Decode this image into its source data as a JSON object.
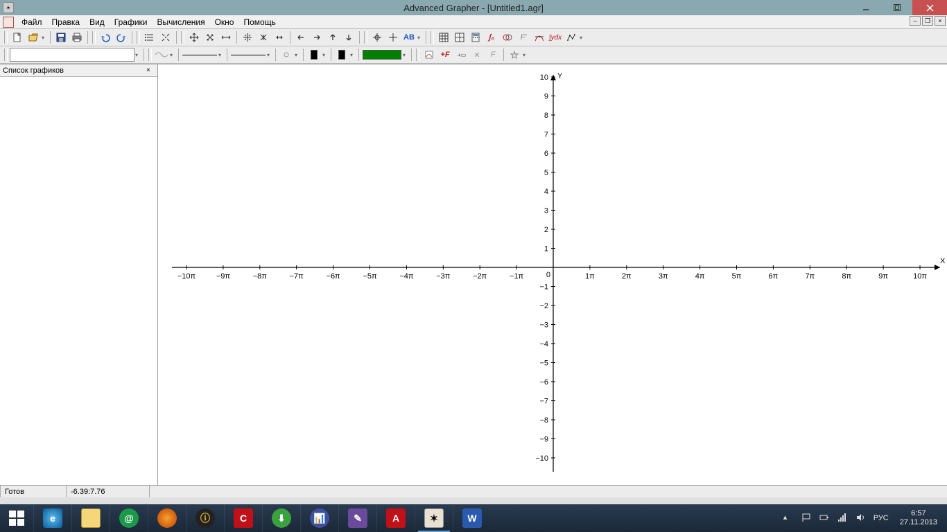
{
  "titlebar": {
    "title": "Advanced Grapher - [Untitled1.agr]"
  },
  "menubar": {
    "items": [
      "Файл",
      "Правка",
      "Вид",
      "Графики",
      "Вычисления",
      "Окно",
      "Помощь"
    ]
  },
  "toolbar1": {
    "icons": [
      "new-file-icon",
      "open-file-icon",
      "save-icon",
      "print-icon",
      "undo-icon",
      "redo-icon",
      "list-icon",
      "fit-icon",
      "pan-icon",
      "zoom-icon",
      "zoom-h-icon",
      "zoom-center-icon",
      "zoom-v-icon",
      "resize-h-icon",
      "arrow-left-icon",
      "arrow-right-icon",
      "arrow-up-icon",
      "arrow-down-icon",
      "crosshair-icon",
      "axes-icon",
      "label-ab-icon",
      "table-icon",
      "grid-icon",
      "calc-icon",
      "integral-red-icon",
      "intersect-icon",
      "derivative-icon",
      "tangent-icon",
      "integral-icon",
      "poly-icon"
    ]
  },
  "toolbar2": {
    "formula": ""
  },
  "sidebar": {
    "title": "Список графиков"
  },
  "chart_data": {
    "type": "scatter",
    "title": "",
    "xlabel": "X",
    "ylabel": "Y",
    "x_tick_format": "pi",
    "xlim": [
      -10,
      10
    ],
    "ylim": [
      -10,
      10
    ],
    "x_ticks": [
      "−10π",
      "−9π",
      "−8π",
      "−7π",
      "−6π",
      "−5π",
      "−4π",
      "−3π",
      "−2π",
      "−1π",
      "0",
      "1π",
      "2π",
      "3π",
      "4π",
      "5π",
      "6π",
      "7π",
      "8π",
      "9π",
      "10π"
    ],
    "y_ticks": [
      "−10",
      "−9",
      "−8",
      "−7",
      "−6",
      "−5",
      "−4",
      "−3",
      "−2",
      "−1",
      "0",
      "1",
      "2",
      "3",
      "4",
      "5",
      "6",
      "7",
      "8",
      "9",
      "10"
    ],
    "series": []
  },
  "statusbar": {
    "ready": "Готов",
    "coords": "-6.39:7.76"
  },
  "tray": {
    "lang": "РУС",
    "time": "6:57",
    "date": "27.11.2013"
  }
}
